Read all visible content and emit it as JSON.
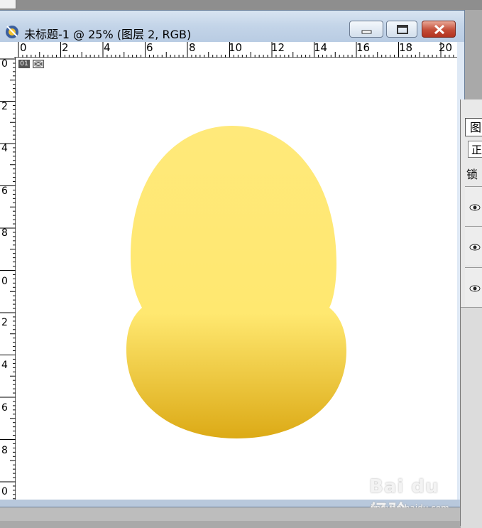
{
  "window": {
    "title": "未标题-1 @ 25% (图层 2, RGB)"
  },
  "ruler_top": [
    "0",
    "2",
    "4",
    "6",
    "8",
    "10",
    "12",
    "14",
    "16",
    "18",
    "20"
  ],
  "ruler_left": [
    "0",
    "2",
    "4",
    "6",
    "8",
    "0",
    "2",
    "4",
    "6",
    "8",
    "0"
  ],
  "canvas": {
    "layer_badge": "01",
    "shape": {
      "type": "gourd",
      "top_color": "#ffe97a",
      "bottom_color": "#dcaa16"
    }
  },
  "layers_panel": {
    "tab_label": "图",
    "mode_label": "正",
    "lock_label": "锁"
  },
  "watermark": {
    "logo": "Bai du 经验",
    "url": "jingyan.baidu.com"
  }
}
